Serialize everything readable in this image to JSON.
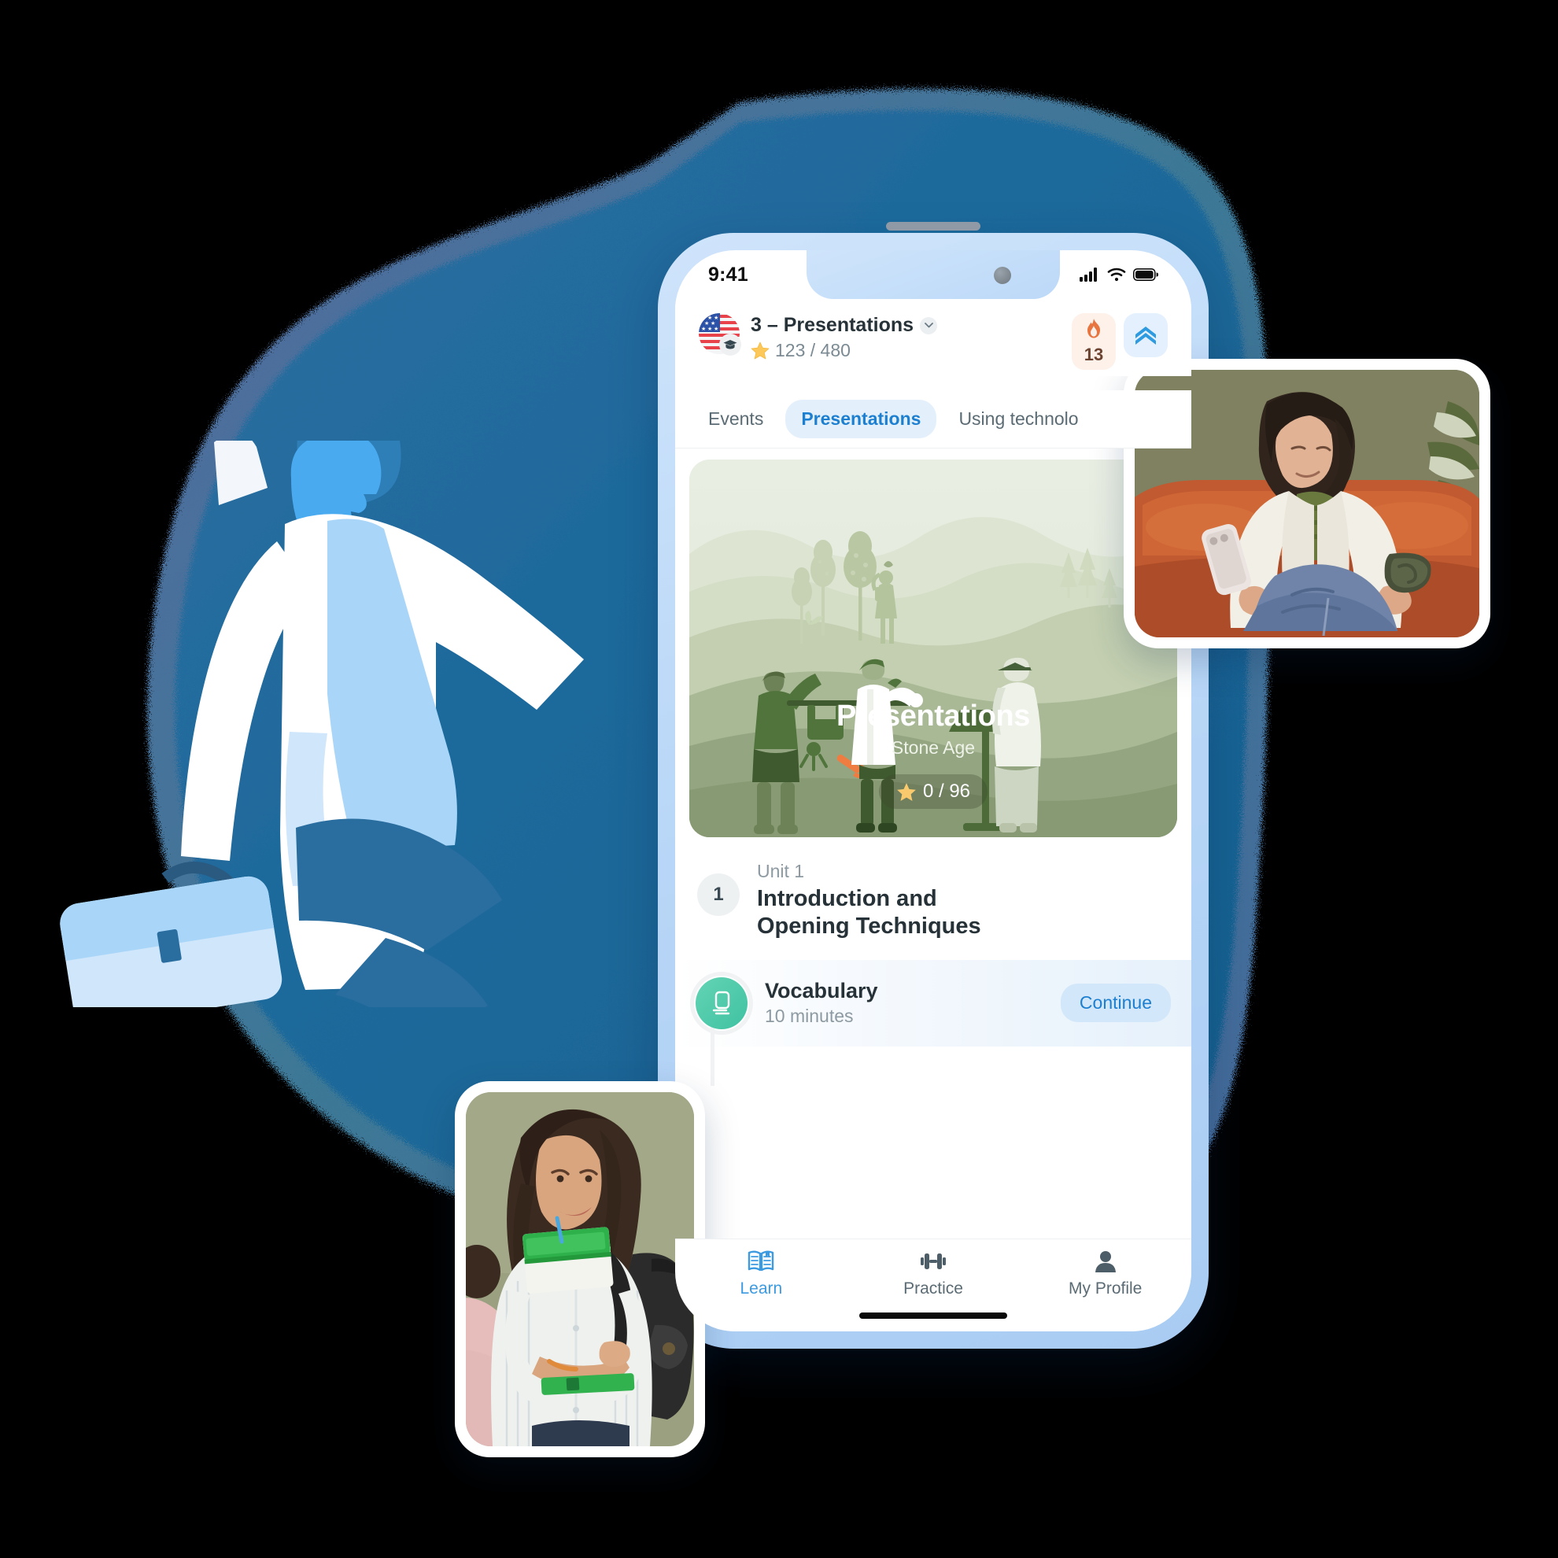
{
  "app": {
    "statusbar": {
      "time": "9:41",
      "icons": [
        "cellular-signal-icon",
        "wifi-icon",
        "battery-icon"
      ]
    },
    "header": {
      "avatar_icon": "us-flag-avatar",
      "badge_icon": "graduation-cap-icon",
      "course_title": "3 – Presentations",
      "dropdown_icon": "chevron-down-icon",
      "xp_icon": "star-icon",
      "xp_text": "123 / 480",
      "streak": {
        "icon": "flame-icon",
        "count": "13"
      },
      "level": {
        "icon": "double-chevron-up-icon"
      }
    },
    "tabs": [
      {
        "label": "Events",
        "active": false
      },
      {
        "label": "Presentations",
        "active": true
      },
      {
        "label": "Using technolo",
        "active": false
      }
    ],
    "hero": {
      "title": "Presentations",
      "subtitle": "Stone Age",
      "badge_icon": "star-icon",
      "badge_text": "0 / 96",
      "illustration": "stone-age-presentation-scene"
    },
    "unit": {
      "number": "1",
      "label": "Unit 1",
      "title": "Introduction and\nOpening Techniques"
    },
    "lesson": {
      "icon": "flashcard-icon",
      "title": "Vocabulary",
      "duration": "10 minutes",
      "action_label": "Continue"
    },
    "tabbar": [
      {
        "label": "Learn",
        "icon": "open-book-icon",
        "active": true
      },
      {
        "label": "Practice",
        "icon": "dumbbell-icon",
        "active": false
      },
      {
        "label": "My Profile",
        "icon": "person-icon",
        "active": false
      }
    ]
  },
  "photos": [
    {
      "name": "woman-on-sofa-with-phone"
    },
    {
      "name": "student-with-notebooks"
    }
  ],
  "decor": {
    "person_illustration": "businessman-with-briefcase",
    "blob": "blue-organic-blob"
  },
  "colors": {
    "accent_blue": "#3c9ae0",
    "link_blue": "#1d7fd0",
    "tab_active_bg": "#e3f0fc",
    "streak_bg": "#fdf1ea",
    "streak_text": "#6b4330",
    "level_bg": "#e4f0fd",
    "hero_green": "#7e8d68",
    "lesson_teal": "#3fc2a2",
    "blob_blue": "#1d6699",
    "phone_body": "#c3dcf8",
    "text_dark": "#263238",
    "text_muted": "#8d9aa2"
  }
}
